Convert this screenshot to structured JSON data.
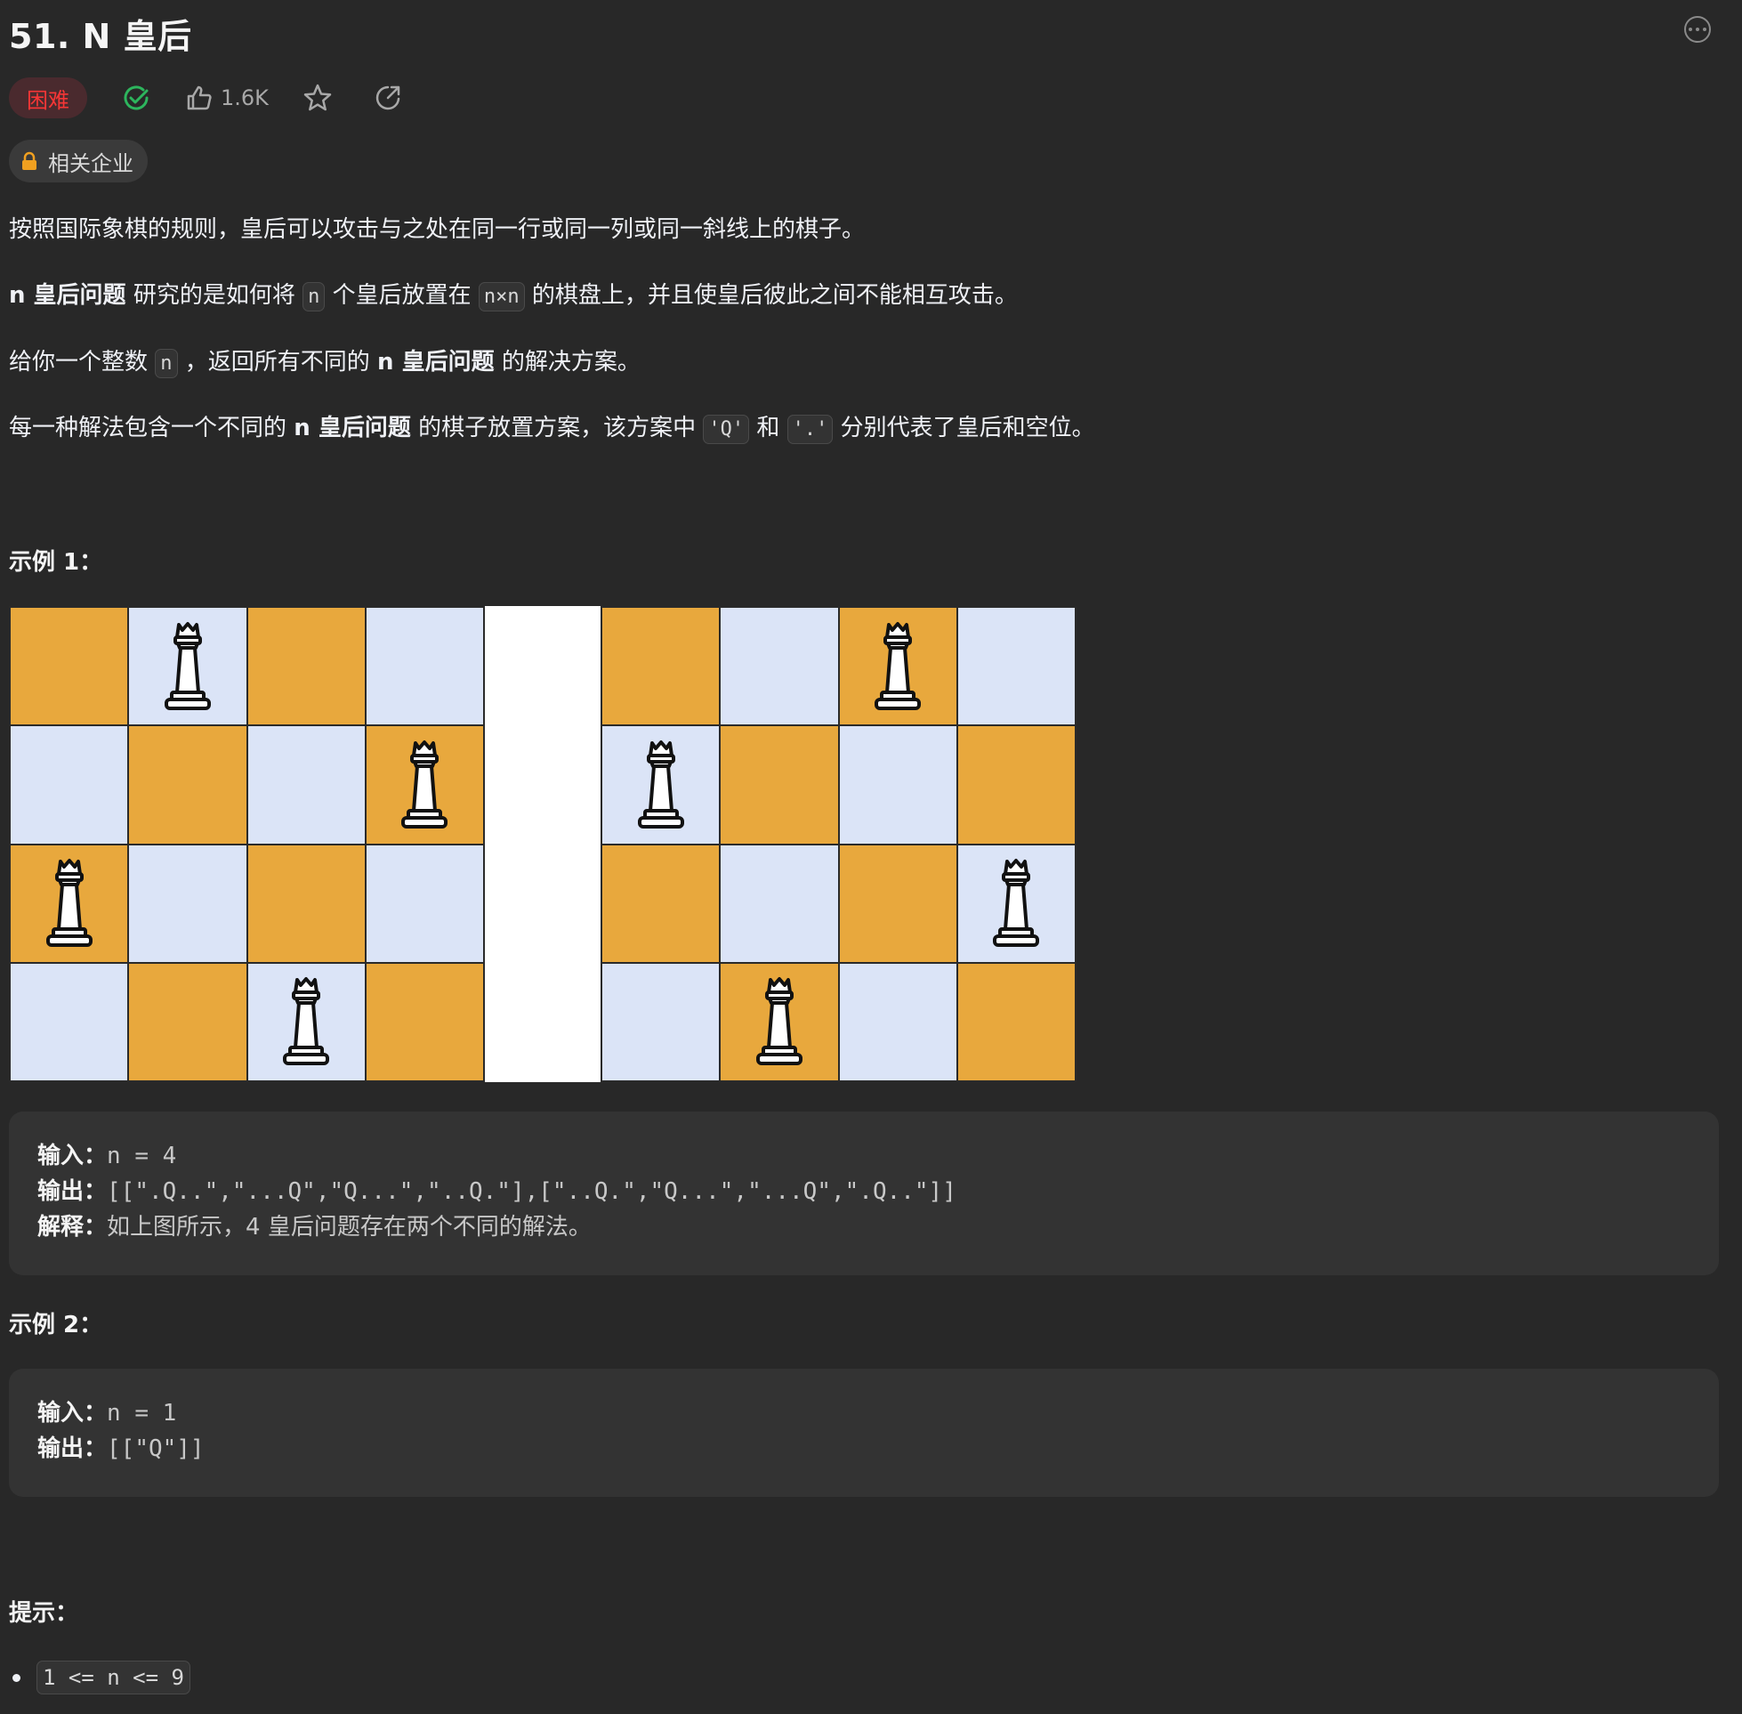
{
  "problem": {
    "title": "51. N 皇后",
    "difficulty": "困难",
    "likes": "1.6K",
    "company_tag": "相关企业"
  },
  "description": {
    "p1": "按照国际象棋的规则，皇后可以攻击与之处在同一行或同一列或同一斜线上的棋子。",
    "p2": {
      "b1": "n 皇后问题",
      "t1": " 研究的是如何将 ",
      "c1": "n",
      "t2": " 个皇后放置在 ",
      "c2": "n×n",
      "t3": " 的棋盘上，并且使皇后彼此之间不能相互攻击。"
    },
    "p3": {
      "t1": "给你一个整数 ",
      "c1": "n",
      "t2": " ，返回所有不同的 ",
      "b1": "n 皇后问题",
      "t3": " 的解决方案。"
    },
    "p4": {
      "t1": "每一种解法包含一个不同的 ",
      "b1": "n 皇后问题",
      "t2": " 的棋子放置方案，该方案中 ",
      "c1": "'Q'",
      "t3": " 和 ",
      "c2": "'.'",
      "t4": " 分别代表了皇后和空位。"
    }
  },
  "example1": {
    "heading": "示例 1：",
    "boards": [
      [
        ".Q..",
        "...Q",
        "Q...",
        "..Q."
      ],
      [
        "..Q.",
        "Q...",
        "...Q",
        ".Q.."
      ]
    ],
    "input_label": "输入：",
    "input_value": "n = 4",
    "output_label": "输出：",
    "output_value": "[[\".Q..\",\"...Q\",\"Q...\",\"..Q.\"],[\"..Q.\",\"Q...\",\"...Q\",\".Q..\"]]",
    "explain_label": "解释：",
    "explain_value": "如上图所示，4 皇后问题存在两个不同的解法。"
  },
  "example2": {
    "heading": "示例 2：",
    "input_label": "输入：",
    "input_value": "n = 1",
    "output_label": "输出：",
    "output_value": "[[\"Q\"]]"
  },
  "hints": {
    "heading": "提示：",
    "items": [
      "1 <= n <= 9"
    ]
  },
  "colors": {
    "background": "#282828",
    "hard_tag_text": "#f63636",
    "hard_tag_bg": "#4a2a2e",
    "check_green": "#2db55d",
    "board_orange": "#e8a83d",
    "board_light": "#dbe4f7",
    "lock_orange": "#f0a020"
  },
  "icons": [
    "more-icon",
    "check-circle-icon",
    "thumb-up-icon",
    "star-icon",
    "share-icon",
    "lock-icon",
    "queen-icon"
  ]
}
